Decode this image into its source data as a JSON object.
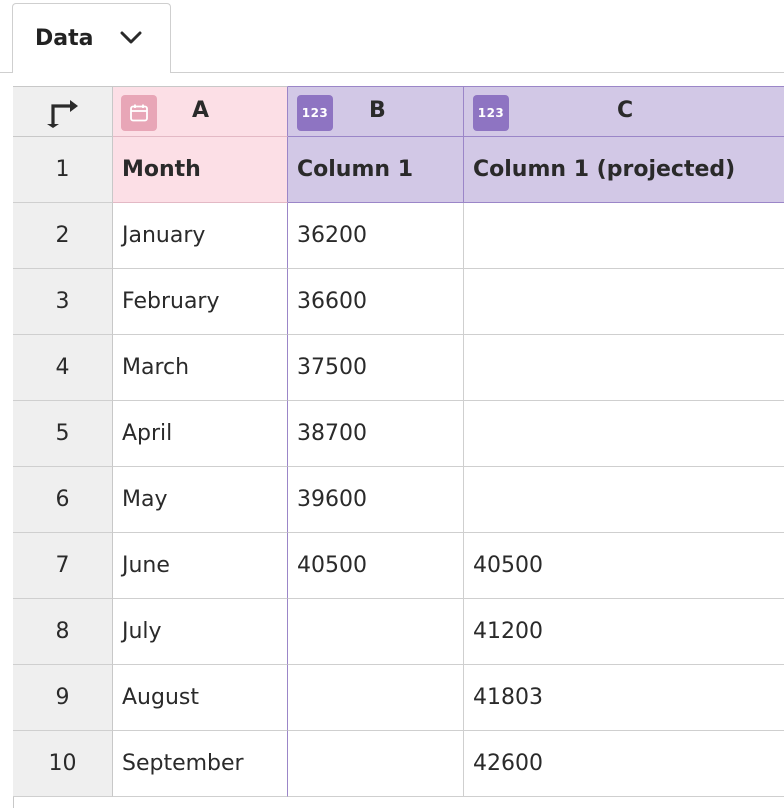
{
  "tab": {
    "label": "Data",
    "chevron_icon": "chevron-down-icon"
  },
  "corner": {
    "icon": "transpose-arrow-icon"
  },
  "columns": [
    {
      "letter": "A",
      "type_icon": "calendar-icon",
      "color": "#fcdfe6"
    },
    {
      "letter": "B",
      "type_label": "123",
      "color": "#d2c8e6"
    },
    {
      "letter": "C",
      "type_label": "123",
      "color": "#d2c8e6"
    }
  ],
  "rows": [
    {
      "num": "1",
      "a": "Month",
      "b": "Column 1",
      "c": "Column 1 (projected)"
    },
    {
      "num": "2",
      "a": "January",
      "b": "36200",
      "c": ""
    },
    {
      "num": "3",
      "a": "February",
      "b": "36600",
      "c": ""
    },
    {
      "num": "4",
      "a": "March",
      "b": "37500",
      "c": ""
    },
    {
      "num": "5",
      "a": "April",
      "b": "38700",
      "c": ""
    },
    {
      "num": "6",
      "a": "May",
      "b": "39600",
      "c": ""
    },
    {
      "num": "7",
      "a": "June",
      "b": "40500",
      "c": "40500"
    },
    {
      "num": "8",
      "a": "July",
      "b": "",
      "c": "41200"
    },
    {
      "num": "9",
      "a": "August",
      "b": "",
      "c": "41803"
    },
    {
      "num": "10",
      "a": "September",
      "b": "",
      "c": "42600"
    }
  ]
}
